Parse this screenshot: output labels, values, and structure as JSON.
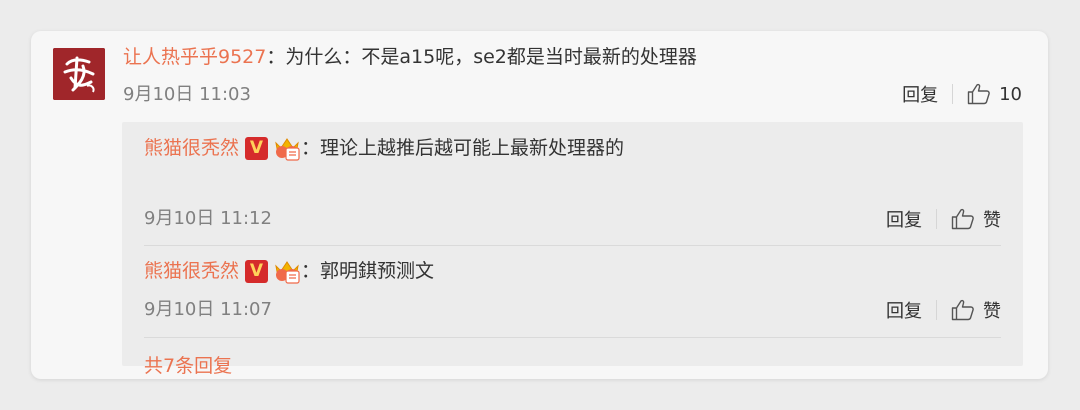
{
  "comment": {
    "username": "让人热乎乎9527",
    "separator": "：",
    "text": "为什么：不是a15呢，se2都是当时最新的处理器",
    "time": "9月10日 11:03",
    "reply_label": "回复",
    "like_count": "10",
    "avatar_icon": "calligraphy-logo-icon"
  },
  "replies": [
    {
      "username": "熊猫很秃然",
      "badge": "V",
      "separator": "：",
      "text": "理论上越推后越可能上最新处理器的",
      "time": "9月10日 11:12",
      "reply_label": "回复",
      "like_label": "赞"
    },
    {
      "username": "熊猫很秃然",
      "badge": "V",
      "separator": "：",
      "text": "郭明錤预测文",
      "time": "9月10日 11:07",
      "reply_label": "回复",
      "like_label": "赞"
    }
  ],
  "more_replies": "共7条回复",
  "colors": {
    "username": "#eb7350",
    "badge_bg": "#d52b2b",
    "badge_fg": "#ffd25a",
    "meta": "#808080"
  }
}
